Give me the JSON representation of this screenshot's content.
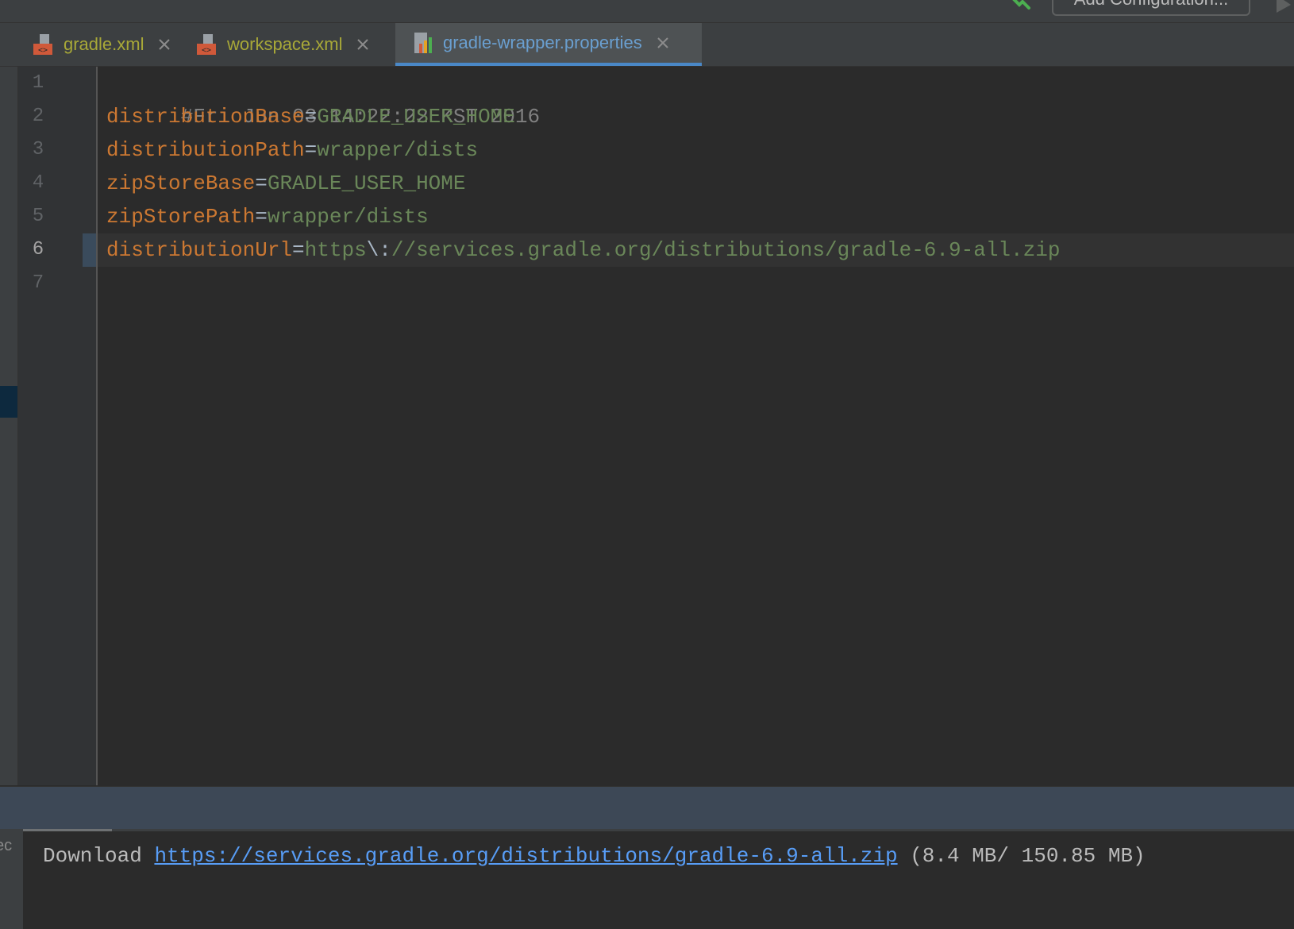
{
  "toolbar": {
    "add_configuration_label": "Add Configuration...",
    "icons": [
      "hammer-icon",
      "run-icon"
    ]
  },
  "tabs": [
    {
      "label": "gradle.xml",
      "icon": "xml-file-icon",
      "active": false,
      "color": "#a8a838"
    },
    {
      "label": "workspace.xml",
      "icon": "xml-file-icon",
      "active": false,
      "color": "#a8a838"
    },
    {
      "label": "gradle-wrapper.properties",
      "icon": "properties-file-icon",
      "active": true,
      "color": "#6a9fd0"
    }
  ],
  "editor": {
    "current_line": 6,
    "line_numbers": [
      "1",
      "2",
      "3",
      "4",
      "5",
      "6",
      "7"
    ],
    "lines": [
      {
        "comment": "#Fri Jun 03 14:22:22 KST 2016"
      },
      {
        "key": "distributionBase",
        "eq": "=",
        "value": "GRADLE_USER_HOME"
      },
      {
        "key": "distributionPath",
        "eq": "=",
        "value": "wrapper/dists"
      },
      {
        "key": "zipStoreBase",
        "eq": "=",
        "value": "GRADLE_USER_HOME"
      },
      {
        "key": "zipStorePath",
        "eq": "=",
        "value": "wrapper/dists"
      },
      {
        "key": "distributionUrl",
        "eq": "=",
        "value_pre": "https",
        "escape": "\\:",
        "value_post": "//services.gradle.org/distributions/gradle-6.9-all.zip"
      },
      {}
    ]
  },
  "bottom_panel": {
    "side_label": "ec",
    "download_prefix": "Download ",
    "download_url": "https://services.gradle.org/distributions/gradle-6.9-all.zip",
    "download_size": " (8.4 MB/ 150.85 MB)",
    "progress_fraction": 0.07
  },
  "colors": {
    "key": "#cc7832",
    "value": "#6a8759",
    "comment": "#808080",
    "link": "#589df6",
    "tab_active_underline": "#4a88c7"
  }
}
